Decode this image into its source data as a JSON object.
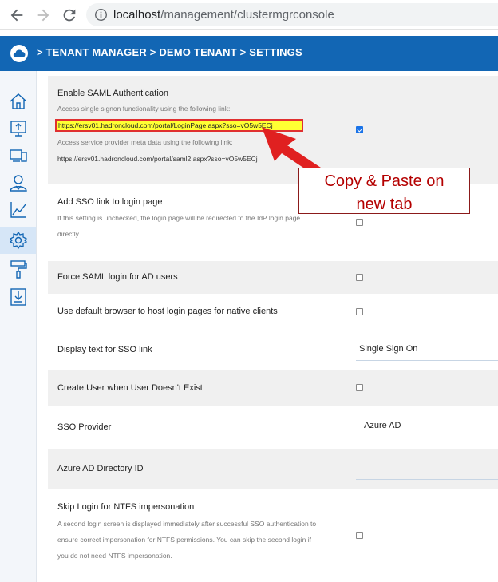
{
  "browser": {
    "url_host": "localhost",
    "url_path": "/management/clustermgrconsole"
  },
  "header": {
    "breadcrumb": "> TENANT MANAGER > DEMO TENANT > SETTINGS"
  },
  "sidebar": {
    "items": [
      {
        "icon": "home-icon"
      },
      {
        "icon": "upload-screen-icon"
      },
      {
        "icon": "devices-icon"
      },
      {
        "icon": "users-icon"
      },
      {
        "icon": "chart-icon"
      },
      {
        "icon": "gear-icon",
        "active": true
      },
      {
        "icon": "paint-roller-icon"
      },
      {
        "icon": "download-icon"
      }
    ]
  },
  "settings": {
    "saml": {
      "label": "Enable SAML Authentication",
      "desc1": "Access single signon functionality using the following link:",
      "login_link": "https://ersv01.hadroncloud.com/portal/LoginPage.aspx?sso=vO5w5ECj",
      "desc2": "Access service provider meta data using the following link:",
      "meta_link": "https://ersv01.hadroncloud.com/portal/saml2.aspx?sso=vO5w5ECj",
      "checked": true
    },
    "sso_link": {
      "label": "Add SSO link to login page",
      "desc1": "If this setting is unchecked, the login page will be redirected to the IdP login page",
      "desc2": "directly."
    },
    "force_saml": {
      "label": "Force SAML login for AD users"
    },
    "default_browser": {
      "label": "Use default browser to host login pages for native clients"
    },
    "display_text": {
      "label": "Display text for SSO link",
      "value": "Single Sign On"
    },
    "create_user": {
      "label": "Create User when User Doesn't Exist"
    },
    "sso_provider": {
      "label": "SSO Provider",
      "value": "Azure AD"
    },
    "azure_dir": {
      "label": "Azure AD Directory ID",
      "value": ""
    },
    "skip_login": {
      "label": "Skip Login for NTFS impersonation",
      "desc1": "A second login screen is displayed immediately after successful SSO authentication to",
      "desc2": "ensure correct impersonation for NTFS permissions. You can skip the second login if",
      "desc3": "you do not need NTFS impersonation."
    }
  },
  "annotation": {
    "line1": "Copy & Paste on",
    "line2": "new tab",
    "color": "#e02020"
  }
}
